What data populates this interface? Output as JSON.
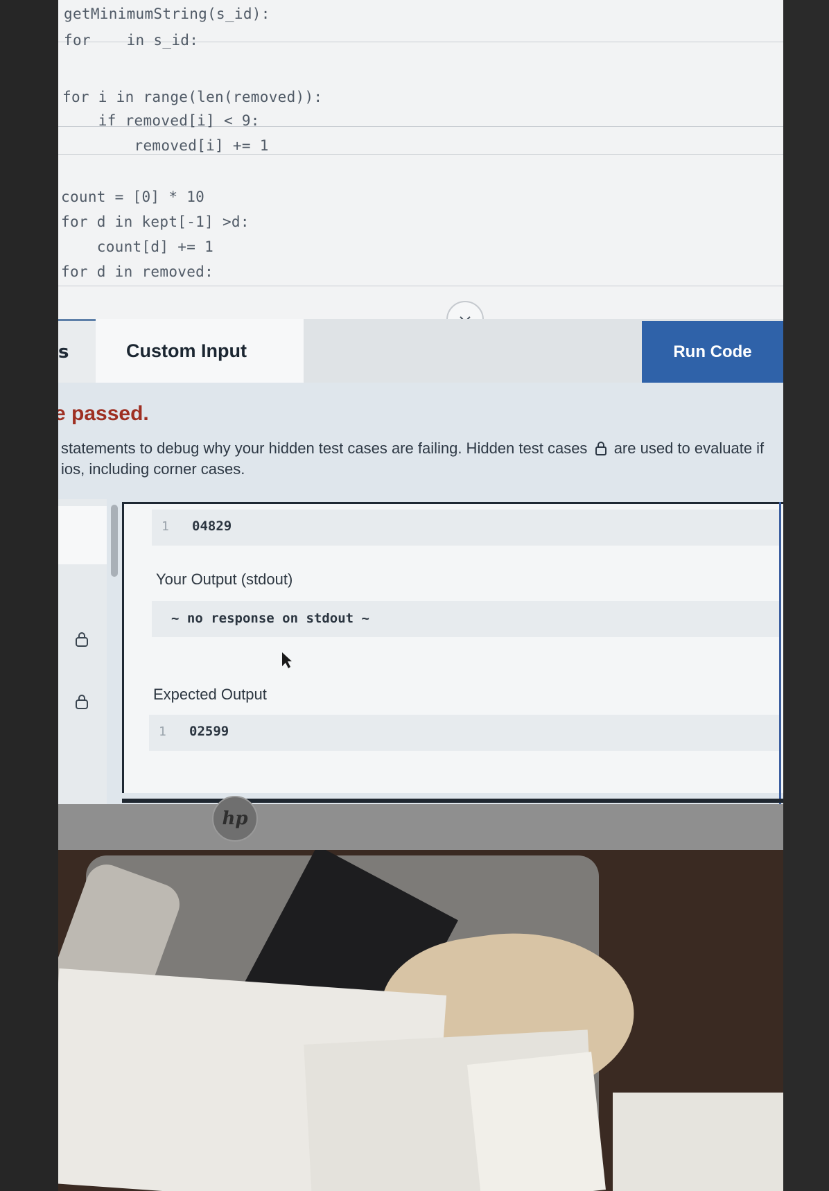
{
  "editor": {
    "lines": [
      {
        "text": "getMinimumString(s_id):"
      },
      {
        "text": "for    in s_id:"
      },
      {
        "text": "for i in range(len(removed)):"
      },
      {
        "text": "    if removed[i] < 9:"
      },
      {
        "text": "        removed[i] += 1"
      },
      {
        "text": "count = [0] * 10"
      },
      {
        "text": "for d in kept[-1] >d:"
      },
      {
        "text": "    count[d] += 1"
      },
      {
        "text": "for d in removed:"
      }
    ]
  },
  "tabs": {
    "left_stub": "s",
    "custom_input": "Custom Input",
    "run_code": "Run Code"
  },
  "results": {
    "status": "e passed.",
    "hint_line1": "statements to debug why your hidden test cases are failing. Hidden test cases",
    "hint_line1_end": "are used to evaluate if",
    "hint_line2": "ios, including corner cases.",
    "input_line_number": "1",
    "input_value": "04829",
    "your_output_label": "Your Output (stdout)",
    "your_output_value": "~ no response on stdout ~",
    "expected_label": "Expected Output",
    "expected_line_number": "1",
    "expected_value": "02599"
  },
  "monitor": {
    "brand": "hp"
  },
  "colors": {
    "run_button": "#2f62a9",
    "status_text": "#9e2f22"
  }
}
